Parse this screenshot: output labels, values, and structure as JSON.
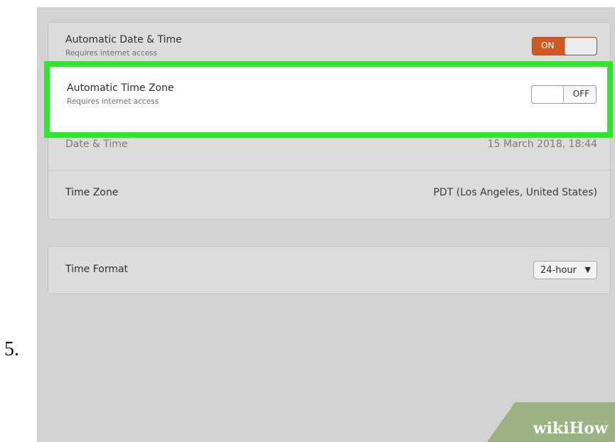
{
  "step": {
    "number": "5."
  },
  "settings": {
    "automatic_date_time": {
      "title": "Automatic Date & Time",
      "subtitle": "Requires internet access",
      "toggle_label": "ON",
      "enabled": true
    },
    "automatic_time_zone": {
      "title": "Automatic Time Zone",
      "subtitle": "Requires internet access",
      "toggle_label": "OFF",
      "enabled": false
    },
    "date_time": {
      "title": "Date & Time",
      "value": "15 March 2018, 18:44"
    },
    "time_zone": {
      "title": "Time Zone",
      "value": "PDT (Los Angeles, United States)"
    },
    "time_format": {
      "title": "Time Format",
      "selected": "24-hour",
      "caret_icon": "chevron-down-icon"
    }
  },
  "watermark": {
    "part1": "wiki",
    "part2": "How"
  },
  "colors": {
    "toggle_on": "#cf5a25",
    "highlight": "#2ee82e",
    "background": "#d3d3d3"
  }
}
